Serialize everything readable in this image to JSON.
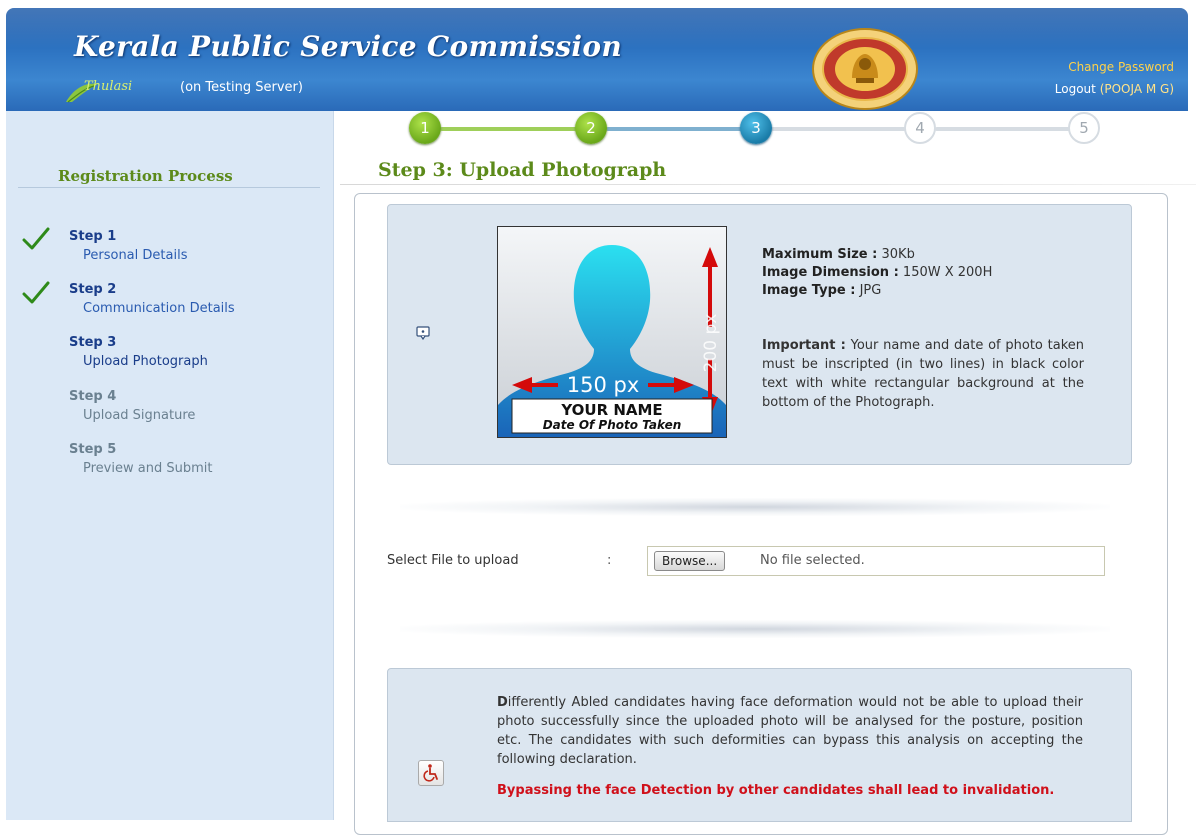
{
  "header": {
    "app_title": "Kerala Public Service Commission",
    "thulasi_label": "Thulasi",
    "server_note": "(on Testing Server)",
    "change_password": "Change Password",
    "logout_label": "Logout",
    "logged_user": "(POOJA M G)"
  },
  "sidebar": {
    "heading": "Registration Process",
    "steps": [
      {
        "title": "Step 1",
        "label": "Personal Details",
        "status": "completed"
      },
      {
        "title": "Step 2",
        "label": "Communication Details",
        "status": "completed"
      },
      {
        "title": "Step 3",
        "label": "Upload Photograph",
        "status": "current"
      },
      {
        "title": "Step 4",
        "label": "Upload Signature",
        "status": "pending"
      },
      {
        "title": "Step 5",
        "label": "Preview and Submit",
        "status": "pending"
      }
    ]
  },
  "progress": {
    "steps": [
      "1",
      "2",
      "3",
      "4",
      "5"
    ],
    "current": 3
  },
  "main": {
    "title": "Step 3: Upload Photograph",
    "sample_photo": {
      "height_label": "200 px",
      "width_label": "150 px",
      "name_label": "YOUR NAME",
      "date_label": "Date Of Photo Taken"
    },
    "specs": {
      "max_size_label": "Maximum Size :",
      "max_size_value": "30Kb",
      "dimension_label": "Image Dimension :",
      "dimension_value": "150W X 200H",
      "type_label": "Image Type :",
      "type_value": "JPG",
      "important_label": "Important :",
      "important_text": "Your name and date of photo taken must be inscripted (in two lines) in black color text with white rectangular background at the bottom of the Photograph."
    },
    "upload": {
      "label": "Select File to upload",
      "colon": ":",
      "browse_button": "Browse...",
      "status": "No file selected."
    },
    "notice": {
      "first_letter": "D",
      "text": "ifferently Abled candidates having face deformation would not be able to upload their photo successfully since the uploaded photo will be analysed for the posture, position etc. The candidates with such deformities can bypass this analysis on accepting the following declaration.",
      "warning": "Bypassing the face Detection by other candidates shall lead to invalidation."
    }
  },
  "colors": {
    "header_blue": "#2f76c4",
    "heading_green": "#5c8a1a",
    "step_done": "#6aa81a",
    "step_active": "#1a7ca8",
    "warning_red": "#d0101a",
    "sidebar_bg": "#dbe8f6"
  },
  "icons": {
    "check": "checkmark-icon",
    "help": "help-icon",
    "accessibility": "wheelchair-icon",
    "emblem": "kpsc-emblem"
  }
}
